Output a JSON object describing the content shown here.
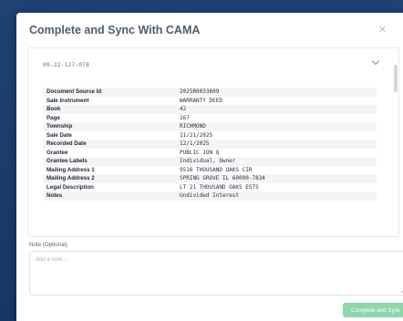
{
  "modal": {
    "title": "Complete and Sync With CAMA",
    "close_icon": "close-icon"
  },
  "record": {
    "parcel_id": "09-22-127-078",
    "expand_icon": "chevron-down-icon",
    "rows": [
      {
        "label": "Document Source Id",
        "value": "2025R0033609"
      },
      {
        "label": "Sale Instrument",
        "value": "WARRANTY DEED"
      },
      {
        "label": "Book",
        "value": "42"
      },
      {
        "label": "Page",
        "value": "167"
      },
      {
        "label": "Township",
        "value": "RICHMOND"
      },
      {
        "label": "Sale Date",
        "value": "11/21/2025"
      },
      {
        "label": "Recorded Date",
        "value": "12/1/2025"
      },
      {
        "label": "Grantee",
        "value": "PUBLIC JON Q"
      },
      {
        "label": "Grantee Labels",
        "value": "Individual, Owner"
      },
      {
        "label": "Mailing Address 1",
        "value": "9516 THOUSAND OAKS CIR"
      },
      {
        "label": "Mailing Address 2",
        "value": "SPRING GROVE IL 60090-7834"
      },
      {
        "label": "Legal Description",
        "value": "LT 21 THOUSAND OAKS ESTS"
      },
      {
        "label": "Notes",
        "value": "Undivided Interest"
      }
    ]
  },
  "note": {
    "label": "Note (Optional)",
    "placeholder": "Add a note...",
    "value": ""
  },
  "actions": {
    "submit_label": "Complete and Sync"
  },
  "colors": {
    "backdrop": "#1b3f6e",
    "submit_button": "#8fd6a8",
    "row_stripe": "#f3f4f6"
  }
}
